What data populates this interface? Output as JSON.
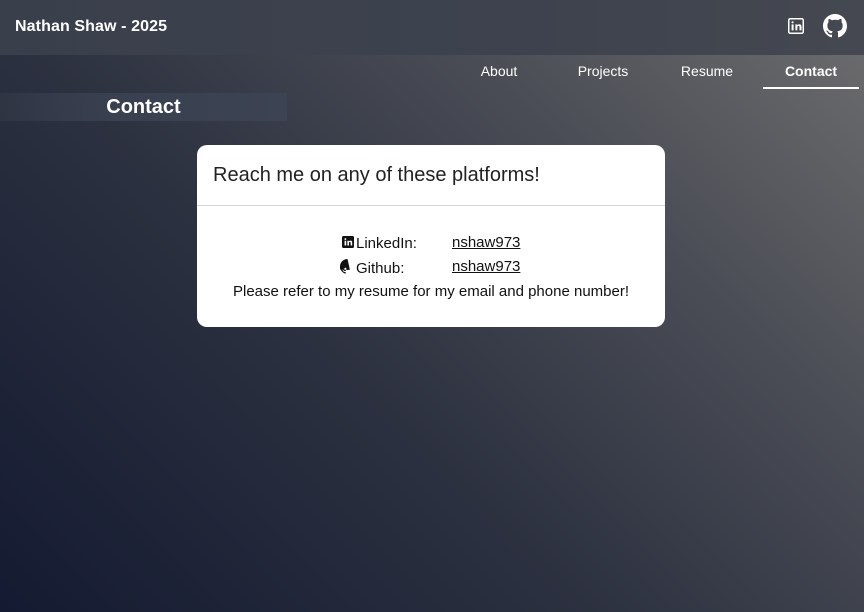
{
  "header": {
    "brand": "Nathan Shaw - 2025",
    "icons": [
      "linkedin-icon",
      "github-icon"
    ]
  },
  "nav": {
    "items": [
      {
        "label": "About",
        "active": false
      },
      {
        "label": "Projects",
        "active": false
      },
      {
        "label": "Resume",
        "active": false
      },
      {
        "label": "Contact",
        "active": true
      }
    ]
  },
  "section": {
    "title": "Contact"
  },
  "card": {
    "heading": "Reach me on any of these platforms!",
    "rows": [
      {
        "icon": "linkedin-icon",
        "label": "LinkedIn:",
        "handle": "nshaw973"
      },
      {
        "icon": "github-icon",
        "label": "Github:",
        "handle": "nshaw973"
      }
    ],
    "note": "Please refer to my resume for my email and phone number!"
  },
  "colors": {
    "header_bg": "#3a3f4c",
    "card_bg": "#ffffff",
    "text_light": "#ffffff"
  }
}
